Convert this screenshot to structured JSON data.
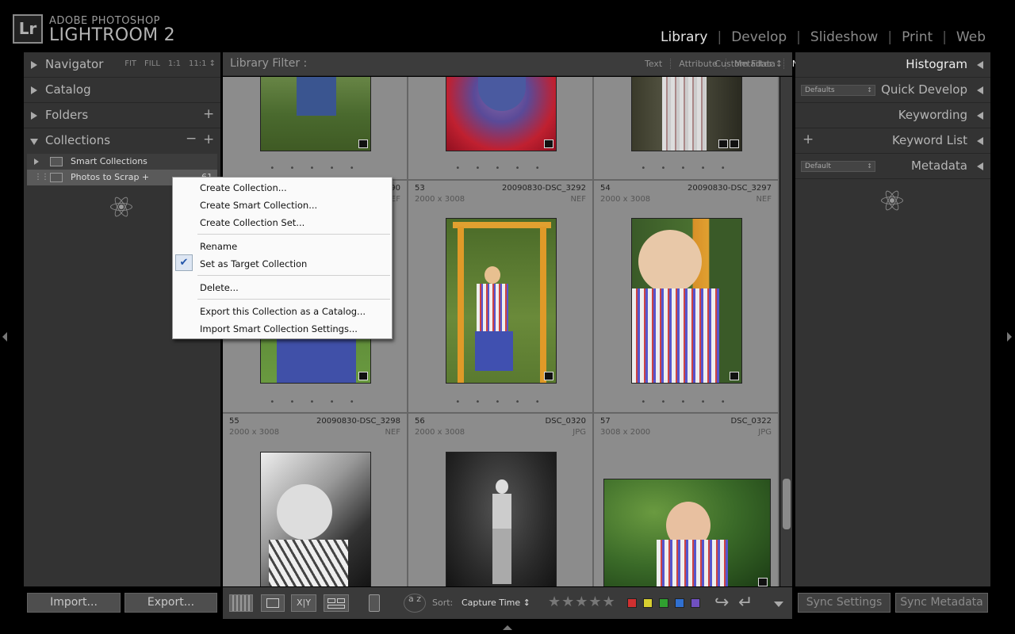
{
  "app": {
    "brand_line1": "ADOBE PHOTOSHOP",
    "brand_line2": "LIGHTROOM 2",
    "logo_text": "Lr"
  },
  "modules": [
    {
      "label": "Library",
      "active": true
    },
    {
      "label": "Develop"
    },
    {
      "label": "Slideshow"
    },
    {
      "label": "Print"
    },
    {
      "label": "Web"
    }
  ],
  "left_panel": {
    "navigator": {
      "label": "Navigator",
      "options": [
        "FIT",
        "FILL",
        "1:1",
        "11:1 ↕"
      ]
    },
    "catalog": {
      "label": "Catalog"
    },
    "folders": {
      "label": "Folders",
      "add": "+"
    },
    "collections": {
      "label": "Collections",
      "remove": "−",
      "add": "+",
      "items": [
        {
          "label": "Smart Collections",
          "count": ""
        },
        {
          "label": "Photos to Scrap  +",
          "count": "61"
        }
      ]
    },
    "import_label": "Import...",
    "export_label": "Export..."
  },
  "filter_bar": {
    "title": "Library Filter :",
    "options": [
      {
        "label": "Text"
      },
      {
        "label": "Attribute"
      },
      {
        "label": "Metadata"
      },
      {
        "label": "None",
        "active": true
      }
    ],
    "custom": "Custom Filter ↕"
  },
  "grid": {
    "row0": [
      {
        "stars": "• • • • •"
      },
      {
        "stars": "• • • • •"
      },
      {
        "stars": "• • • • •"
      }
    ],
    "row1": [
      {
        "num": "",
        "name": "…90",
        "dim": "",
        "ext": "NEF"
      },
      {
        "num": "53",
        "name": "20090830-DSC_3292",
        "dim": "2000 x 3008",
        "ext": "NEF"
      },
      {
        "num": "54",
        "name": "20090830-DSC_3297",
        "dim": "2000 x 3008",
        "ext": "NEF"
      }
    ],
    "row1_stars": "• • • • •",
    "row2": [
      {
        "num": "55",
        "name": "20090830-DSC_3298",
        "dim": "2000 x 3008",
        "ext": "NEF"
      },
      {
        "num": "56",
        "name": "DSC_0320",
        "dim": "2000 x 3008",
        "ext": "JPG"
      },
      {
        "num": "57",
        "name": "DSC_0322",
        "dim": "3008 x 2000",
        "ext": "JPG"
      }
    ]
  },
  "context_menu": {
    "items": [
      "Create Collection...",
      "Create Smart Collection...",
      "Create Collection Set...",
      "Rename",
      "Set as Target Collection",
      "Delete...",
      "Export this Collection as a Catalog...",
      "Import Smart Collection Settings..."
    ],
    "checked_item": "Set as Target Collection",
    "check_glyph": "✔"
  },
  "toolbar": {
    "sort_label": "Sort:",
    "sort_value": "Capture Time ↕",
    "stars": "★★★★★",
    "xy": "X|Y",
    "az": "a z",
    "colors": [
      "#d03030",
      "#d8d030",
      "#30a030",
      "#3070d0",
      "#7050c0"
    ]
  },
  "right_panel": {
    "histogram": "Histogram",
    "quick_develop": "Quick Develop",
    "quick_develop_preset": "Defaults",
    "keywording": "Keywording",
    "keyword_list": "Keyword List",
    "keyword_add": "+",
    "metadata": "Metadata",
    "metadata_preset": "Default",
    "sync_settings": "Sync Settings",
    "sync_metadata": "Sync Metadata"
  }
}
